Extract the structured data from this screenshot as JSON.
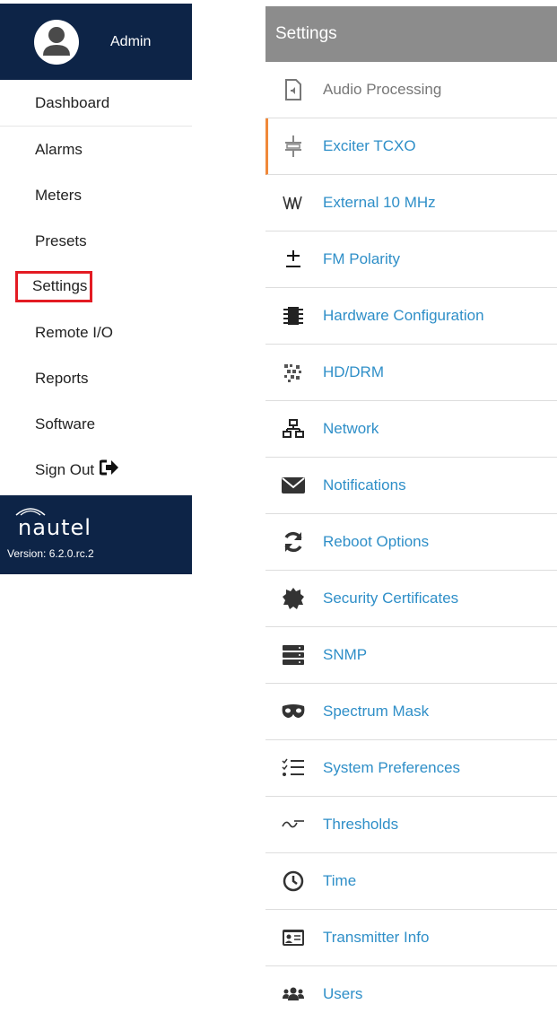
{
  "user": {
    "name": "Admin"
  },
  "nav": {
    "items": [
      {
        "label": "Dashboard"
      },
      {
        "label": "Alarms"
      },
      {
        "label": "Meters"
      },
      {
        "label": "Presets"
      },
      {
        "label": "Settings",
        "active": true
      },
      {
        "label": "Remote I/O"
      },
      {
        "label": "Reports"
      },
      {
        "label": "Software"
      },
      {
        "label": "Sign Out",
        "icon": "sign-out-icon"
      }
    ]
  },
  "brand": {
    "name": "nautel",
    "version": "Version: 6.2.0.rc.2"
  },
  "settings": {
    "title": "Settings",
    "items": [
      {
        "label": "Audio Processing",
        "icon": "audio-file-icon",
        "state": "disabled"
      },
      {
        "label": "Exciter TCXO",
        "icon": "crystal-icon",
        "state": "selected"
      },
      {
        "label": "External 10 MHz",
        "icon": "waveform-icon"
      },
      {
        "label": "FM Polarity",
        "icon": "plus-minus-icon"
      },
      {
        "label": "Hardware Configuration",
        "icon": "chip-icon"
      },
      {
        "label": "HD/DRM",
        "icon": "pixels-icon"
      },
      {
        "label": "Network",
        "icon": "network-icon"
      },
      {
        "label": "Notifications",
        "icon": "envelope-icon"
      },
      {
        "label": "Reboot Options",
        "icon": "refresh-icon"
      },
      {
        "label": "Security Certificates",
        "icon": "certificate-icon"
      },
      {
        "label": "SNMP",
        "icon": "server-icon"
      },
      {
        "label": "Spectrum Mask",
        "icon": "mask-icon"
      },
      {
        "label": "System Preferences",
        "icon": "checklist-icon"
      },
      {
        "label": "Thresholds",
        "icon": "threshold-icon"
      },
      {
        "label": "Time",
        "icon": "clock-icon"
      },
      {
        "label": "Transmitter Info",
        "icon": "id-card-icon"
      },
      {
        "label": "Users",
        "icon": "users-icon"
      }
    ]
  },
  "colors": {
    "sidebar_bg": "#0d2447",
    "header_bg": "#8c8c8c",
    "link": "#2f8fc8",
    "selected_accent": "#f0883a",
    "highlight_box": "#e31b23"
  }
}
